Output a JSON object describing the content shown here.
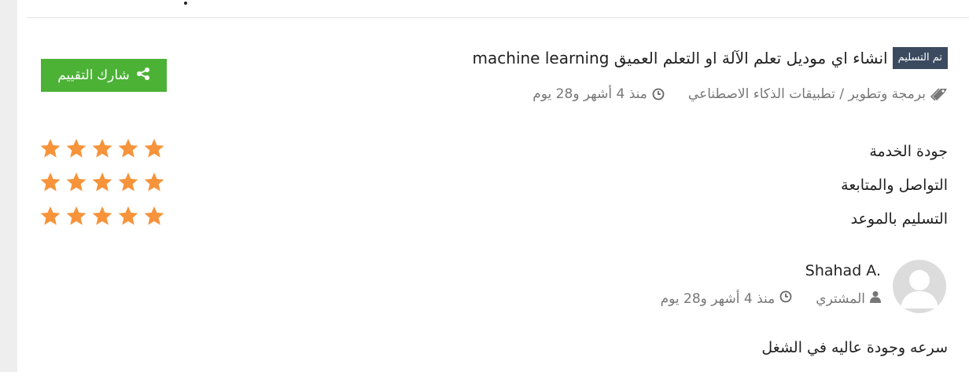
{
  "project": {
    "status_badge": "تم التسليم",
    "title": "انشاء اي موديل تعلم الآلة او التعلم العميق machine learning",
    "category": "برمجة وتطوير / تطبيقات الذكاء الاصطناعي",
    "time_ago": "منذ 4 أشهر و28 يوم"
  },
  "share_button": {
    "label": "شارك التقييم",
    "icon": "share-icon"
  },
  "ratings": [
    {
      "label": "جودة الخدمة",
      "stars": 5
    },
    {
      "label": "التواصل والمتابعة",
      "stars": 5
    },
    {
      "label": "التسليم بالموعد",
      "stars": 5
    }
  ],
  "reviewer": {
    "name": "Shahad A.",
    "role": "المشتري",
    "time_ago": "منذ 4 أشهر و28 يوم"
  },
  "review_text": "سرعه وجودة عاليه في الشغل",
  "colors": {
    "star": "#f7933a",
    "share": "#4cb236",
    "badge": "#3b4a5f"
  }
}
